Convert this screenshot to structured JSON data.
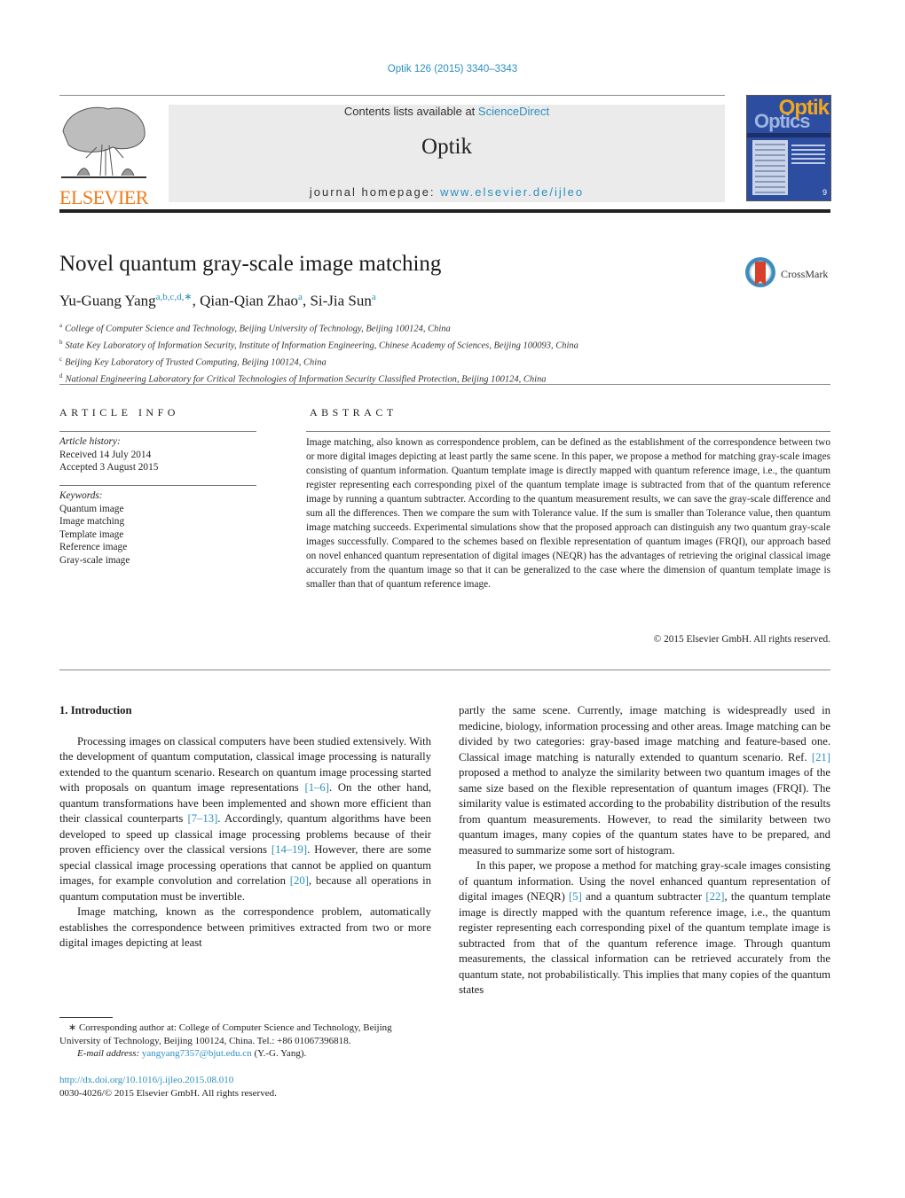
{
  "header": {
    "citation": "Optik 126 (2015) 3340–3343",
    "contents_prefix": "Contents lists available at ",
    "contents_link": "ScienceDirect",
    "journal_name": "Optik",
    "homepage_prefix": "journal homepage: ",
    "homepage_link": "www.elsevier.de/ijleo",
    "publisher_logo_text": "ELSEVIER",
    "cover": {
      "title_top": "Optik",
      "title_bottom": "Optics",
      "issue_number": "9"
    },
    "crossmark_label": "CrossMark",
    "colors": {
      "link": "#2b8fbf",
      "elsevier_orange": "#f07a18",
      "banner_bg": "#ebebeb"
    }
  },
  "article": {
    "title": "Novel quantum gray-scale image matching",
    "authors": [
      {
        "name": "Yu-Guang Yang",
        "marks": "a,b,c,d,∗",
        "sep": ", "
      },
      {
        "name": "Qian-Qian Zhao",
        "marks": "a",
        "sep": ", "
      },
      {
        "name": "Si-Jia Sun",
        "marks": "a",
        "sep": ""
      }
    ],
    "affiliations": [
      {
        "mark": "a",
        "text": "College of Computer Science and Technology, Beijing University of Technology, Beijing 100124, China"
      },
      {
        "mark": "b",
        "text": "State Key Laboratory of Information Security, Institute of Information Engineering, Chinese Academy of Sciences, Beijing 100093, China"
      },
      {
        "mark": "c",
        "text": "Beijing Key Laboratory of Trusted Computing, Beijing 100124, China"
      },
      {
        "mark": "d",
        "text": "National Engineering Laboratory for Critical Technologies of Information Security Classified Protection, Beijing 100124, China"
      }
    ]
  },
  "article_info": {
    "heading": "ARTICLE INFO",
    "history_label": "Article history:",
    "received": "Received 14 July 2014",
    "accepted": "Accepted 3 August 2015",
    "keywords_label": "Keywords:",
    "keywords": [
      "Quantum image",
      "Image matching",
      "Template image",
      "Reference image",
      "Gray-scale image"
    ]
  },
  "abstract": {
    "heading": "ABSTRACT",
    "text": "Image matching, also known as correspondence problem, can be defined as the establishment of the correspondence between two or more digital images depicting at least partly the same scene. In this paper, we propose a method for matching gray-scale images consisting of quantum information. Quantum template image is directly mapped with quantum reference image, i.e., the quantum register representing each corresponding pixel of the quantum template image is subtracted from that of the quantum reference image by running a quantum subtracter. According to the quantum measurement results, we can save the gray-scale difference and sum all the differences. Then we compare the sum with Tolerance value. If the sum is smaller than Tolerance value, then quantum image matching succeeds. Experimental simulations show that the proposed approach can distinguish any two quantum gray-scale images successfully. Compared to the schemes based on flexible representation of quantum images (FRQI), our approach based on novel enhanced quantum representation of digital images (NEQR) has the advantages of retrieving the original classical image accurately from the quantum image so that it can be generalized to the case where the dimension of quantum template image is smaller than that of quantum reference image.",
    "copyright": "© 2015 Elsevier GmbH. All rights reserved."
  },
  "introduction": {
    "title": "1.  Introduction",
    "p1": [
      {
        "t": "Processing images on classical computers have been studied extensively. With the development of quantum computation, classical image processing is naturally extended to the quantum scenario. Research on quantum image processing started with proposals on quantum image representations "
      },
      {
        "ref": "[1–6]"
      },
      {
        "t": ". On the other hand, quantum transformations have been implemented and shown more efficient than their classical counterparts "
      },
      {
        "ref": "[7–13]"
      },
      {
        "t": ". Accordingly, quantum algorithms have been developed to speed up classical image processing problems because of their proven efficiency over the classical versions "
      },
      {
        "ref": "[14–19]"
      },
      {
        "t": ". However, there are some special classical image processing operations that cannot be applied on quantum images, for example convolution and correlation "
      },
      {
        "ref": "[20]"
      },
      {
        "t": ", because all operations in quantum computation must be invertible."
      }
    ],
    "p2": [
      {
        "t": "Image matching, known as the correspondence problem, automatically establishes the correspondence between primitives extracted from two or more digital images depicting at least"
      }
    ],
    "p2_cont": [
      {
        "t": "partly the same scene. Currently, image matching is widespreadly used in medicine, biology, information processing and other areas. Image matching can be divided by two categories: gray-based image matching and feature-based one. Classical image matching is naturally extended to quantum scenario. Ref. "
      },
      {
        "ref": "[21]"
      },
      {
        "t": " proposed a method to analyze the similarity between two quantum images of the same size based on the flexible representation of quantum images (FRQI). The similarity value is estimated according to the probability distribution of the results from quantum measurements. However, to read the similarity between two quantum images, many copies of the quantum states have to be prepared, and measured to summarize some sort of histogram."
      }
    ],
    "p3": [
      {
        "t": "In this paper, we propose a method for matching gray-scale images consisting of quantum information. Using the novel enhanced quantum representation of digital images (NEQR) "
      },
      {
        "ref": "[5]"
      },
      {
        "t": " and a quantum subtracter "
      },
      {
        "ref": "[22]"
      },
      {
        "t": ", the quantum template image is directly mapped with the quantum reference image, i.e., the quantum register representing each corresponding pixel of the quantum template image is subtracted from that of the quantum reference image. Through quantum measurements, the classical information can be retrieved accurately from the quantum state, not probabilistically. This implies that many copies of the quantum states"
      }
    ]
  },
  "footnote": {
    "mark": "∗",
    "text": "Corresponding author at: College of Computer Science and Technology, Beijing University of Technology, Beijing 100124, China. Tel.: +86 01067396818.",
    "email_label": "E-mail address: ",
    "email": "yangyang7357@bjut.edu.cn",
    "email_suffix": " (Y.-G. Yang)."
  },
  "doi": {
    "link": "http://dx.doi.org/10.1016/j.ijleo.2015.08.010",
    "issn": "0030-4026/© 2015 Elsevier GmbH. All rights reserved."
  }
}
